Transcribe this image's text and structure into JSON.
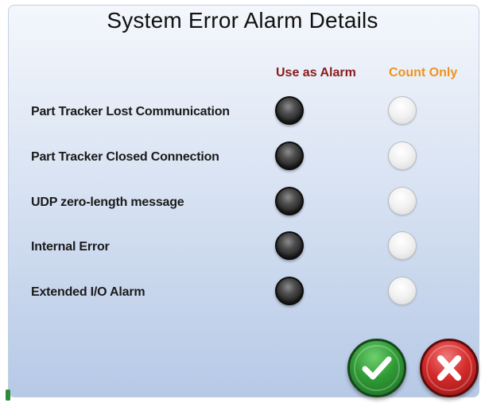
{
  "dialog": {
    "title": "System Error Alarm Details",
    "columns": {
      "alarm_label": "Use as Alarm",
      "count_label": "Count Only"
    },
    "rows": [
      {
        "label": "Part Tracker Lost Communication",
        "selected": "Use as Alarm"
      },
      {
        "label": "Part Tracker Closed Connection",
        "selected": "Use as Alarm"
      },
      {
        "label": "UDP zero-length message",
        "selected": "Use as Alarm"
      },
      {
        "label": "Internal Error",
        "selected": "Use as Alarm"
      },
      {
        "label": "Extended I/O Alarm",
        "selected": "Use as Alarm"
      }
    ],
    "buttons": {
      "ok_icon": "checkmark-icon",
      "cancel_icon": "x-icon"
    },
    "colors": {
      "alarm_header": "#8a1b1b",
      "count_header": "#f0921d",
      "ok_button": "#2f9a35",
      "cancel_button": "#d42a2a"
    }
  }
}
